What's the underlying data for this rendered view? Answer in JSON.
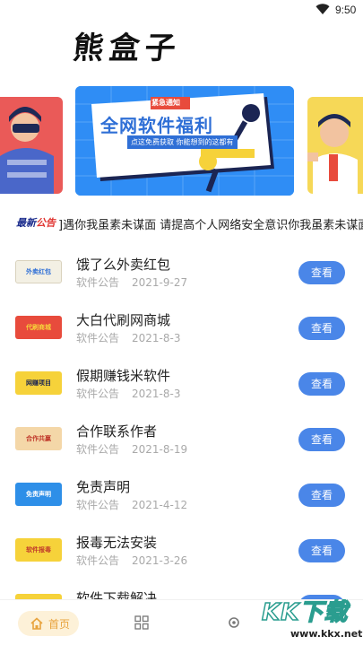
{
  "status_bar": {
    "time": "9:50",
    "wifi_icon": "wifi-icon"
  },
  "header": {
    "logo_text": "熊盒子"
  },
  "banner": {
    "main": {
      "badge": "紧急通知",
      "headline": "全网软件福利",
      "subline": "点这免费获取 你能想到的这都有"
    }
  },
  "marquee": {
    "tag_prefix": "最新",
    "tag_suffix": "公告",
    "text": "]遇你我虽素未谋面 请提高个人网络安全意识你我虽素未谋面 相"
  },
  "notices": [
    {
      "title": "饿了么外卖红包",
      "category": "软件公告",
      "date": "2021-9-27",
      "button": "查看",
      "thumb_color": "#f3f0e4",
      "thumb_text": "外卖红包"
    },
    {
      "title": "大白代刷网商城",
      "category": "软件公告",
      "date": "2021-8-3",
      "button": "查看",
      "thumb_color": "#e84b3c",
      "thumb_text": "代刷商城"
    },
    {
      "title": "假期赚钱米软件",
      "category": "软件公告",
      "date": "2021-8-3",
      "button": "查看",
      "thumb_color": "#f6d23a",
      "thumb_text": "网赚项目"
    },
    {
      "title": "合作联系作者",
      "category": "软件公告",
      "date": "2021-8-19",
      "button": "查看",
      "thumb_color": "#f4d7a8",
      "thumb_text": "合作共赢"
    },
    {
      "title": "免责声明",
      "category": "软件公告",
      "date": "2021-4-12",
      "button": "查看",
      "thumb_color": "#2e8fe8",
      "thumb_text": "免责声明"
    },
    {
      "title": "报毒无法安装",
      "category": "软件公告",
      "date": "2021-3-26",
      "button": "查看",
      "thumb_color": "#f6d23a",
      "thumb_text": "软件报毒"
    },
    {
      "title": "软件下载解决",
      "category": "",
      "date": "",
      "button": "查看",
      "thumb_color": "#f6d23a",
      "thumb_text": "下载解决"
    }
  ],
  "tab_bar": {
    "home_label": "首页",
    "home_icon": "home-icon",
    "grid_icon": "grid-icon",
    "discover_icon": "compass-icon"
  },
  "watermark": {
    "text": "KK下载",
    "url": "www.kkx.net"
  }
}
